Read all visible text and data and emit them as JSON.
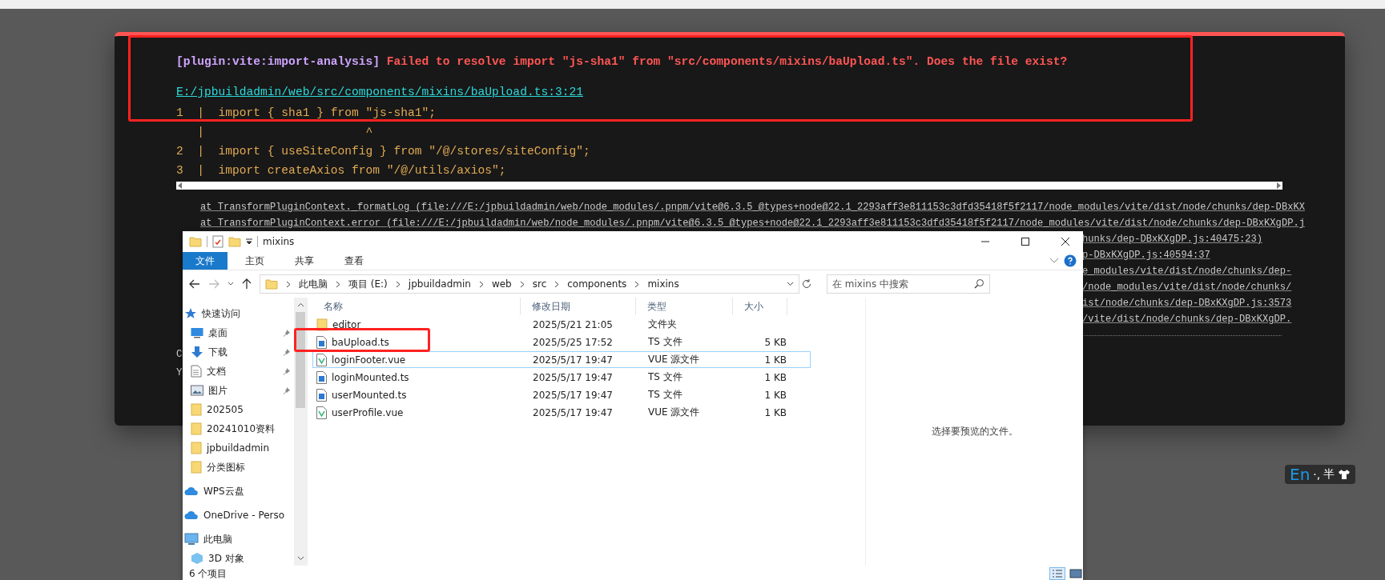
{
  "error_overlay": {
    "plugin": "[plugin:vite:import-analysis]",
    "message": "Failed to resolve import \"js-sha1\" from \"src/components/mixins/baUpload.ts\". Does the file exist?",
    "file_link": "E:/jpbuildadmin/web/src/components/mixins/baUpload.ts:3:21",
    "code_frame": [
      "1  |  import { sha1 } from \"js-sha1\";",
      "   |                       ^",
      "2  |  import { useSiteConfig } from \"/@/stores/siteConfig\";",
      "3  |  import createAxios from \"/@/utils/axios\";"
    ],
    "stack": [
      {
        "kind": "full",
        "text": "at TransformPluginContext._formatLog (file:///E:/jpbuildadmin/web/node_modules/.pnpm/vite@6.3.5_@types+node@22.1_2293aff3e811153c3dfd35418f5f2117/node_modules/vite/dist/node/chunks/dep-DBxKX"
      },
      {
        "kind": "full",
        "text": "at TransformPluginContext.error (file:///E:/jpbuildadmin/web/node_modules/.pnpm/vite@6.3.5_@types+node@22.1_2293aff3e811153c3dfd35418f5f2117/node_modules/vite/dist/node/chunks/dep-DBxKXgDP.j"
      },
      {
        "kind": "tail",
        "text": "hunks/dep-DBxKXgDP.js:40475:23)"
      },
      {
        "kind": "tail",
        "text": "p-DBxKXgDP.js:40594:37"
      },
      {
        "kind": "tail",
        "text": "e_modules/vite/dist/node/chunks/dep-"
      },
      {
        "kind": "tail",
        "text": "/node_modules/vite/dist/node/chunks/"
      },
      {
        "kind": "tail",
        "text": "ist/node/chunks/dep-DBxKXgDP.js:3573"
      },
      {
        "kind": "tail",
        "text": "/vite/dist/node/chunks/dep-DBxKXgDP."
      }
    ],
    "tips": [
      "C",
      "Y"
    ]
  },
  "explorer": {
    "title": "mixins",
    "ribbon_tabs": [
      {
        "label": "文件",
        "selected": true
      },
      {
        "label": "主页",
        "selected": false
      },
      {
        "label": "共享",
        "selected": false
      },
      {
        "label": "查看",
        "selected": false
      }
    ],
    "breadcrumbs": [
      "此电脑",
      "项目 (E:)",
      "jpbuildadmin",
      "web",
      "src",
      "components",
      "mixins"
    ],
    "search": {
      "placeholder": "在 mixins 中搜索"
    },
    "sidebar": [
      {
        "kind": "star",
        "label": "快速访问",
        "pinned": false
      },
      {
        "kind": "desktop",
        "label": "桌面",
        "pinned": true
      },
      {
        "kind": "download",
        "label": "下载",
        "pinned": true
      },
      {
        "kind": "document",
        "label": "文档",
        "pinned": true
      },
      {
        "kind": "picture",
        "label": "图片",
        "pinned": true
      },
      {
        "kind": "folder",
        "label": "202505",
        "pinned": false
      },
      {
        "kind": "folder",
        "label": "20241010资料",
        "pinned": false
      },
      {
        "kind": "folder",
        "label": "jpbuildadmin",
        "pinned": false
      },
      {
        "kind": "folder",
        "label": "分类图标",
        "pinned": false
      },
      {
        "kind": "cloud",
        "label": "WPS云盘",
        "pinned": false
      },
      {
        "kind": "cloud",
        "label": "OneDrive - Perso",
        "pinned": false
      },
      {
        "kind": "computer",
        "label": "此电脑",
        "pinned": false
      },
      {
        "kind": "cube",
        "label": "3D 对象",
        "pinned": false
      }
    ],
    "columns": [
      "名称",
      "修改日期",
      "类型",
      "大小"
    ],
    "files": [
      {
        "kind": "folder",
        "name": "editor",
        "modified": "2025/5/21 21:05",
        "type": "文件夹",
        "selected": false
      },
      {
        "kind": "ts",
        "name": "baUpload.ts",
        "modified": "2025/5/25 17:52",
        "type": "TS 文件",
        "size": "5 KB",
        "selected": false
      },
      {
        "kind": "vue",
        "name": "loginFooter.vue",
        "modified": "2025/5/17 19:47",
        "type": "VUE 源文件",
        "size": "1 KB",
        "selected": true
      },
      {
        "kind": "ts",
        "name": "loginMounted.ts",
        "modified": "2025/5/17 19:47",
        "type": "TS 文件",
        "size": "1 KB",
        "selected": false
      },
      {
        "kind": "ts",
        "name": "userMounted.ts",
        "modified": "2025/5/17 19:47",
        "type": "TS 文件",
        "size": "1 KB",
        "selected": false
      },
      {
        "kind": "vue",
        "name": "userProfile.vue",
        "modified": "2025/5/17 19:47",
        "type": "VUE 源文件",
        "size": "1 KB",
        "selected": false
      }
    ],
    "preview_message": "选择要预览的文件。",
    "status": "6 个项目"
  },
  "ime_indicator": {
    "mode": "En",
    "punctuation": "·,",
    "width": "半"
  }
}
